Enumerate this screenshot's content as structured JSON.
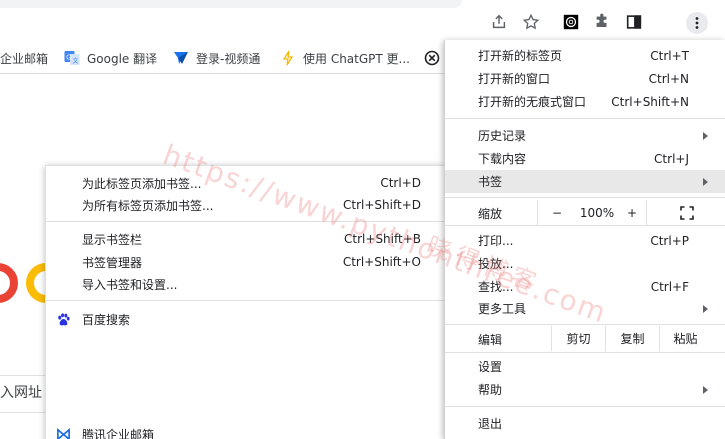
{
  "bookmarks_bar": {
    "items": [
      {
        "label": "企业邮箱"
      },
      {
        "label": "Google 翻译"
      },
      {
        "label": "登录-视频通"
      },
      {
        "label": "使用 ChatGPT 更..."
      }
    ]
  },
  "page": {
    "search_partial": "入网址"
  },
  "bookmark_submenu": {
    "items": [
      {
        "label": "为此标签页添加书签...",
        "shortcut": "Ctrl+D"
      },
      {
        "label": "为所有标签页添加书签...",
        "shortcut": "Ctrl+Shift+D"
      },
      {
        "label": "显示书签栏",
        "shortcut": "Ctrl+Shift+B"
      },
      {
        "label": "书签管理器",
        "shortcut": "Ctrl+Shift+O"
      },
      {
        "label": "导入书签和设置...",
        "shortcut": ""
      },
      {
        "label": "百度搜索",
        "shortcut": ""
      },
      {
        "label": "腾讯企业邮箱",
        "shortcut": ""
      }
    ]
  },
  "main_menu": {
    "new_tab": {
      "label": "打开新的标签页",
      "shortcut": "Ctrl+T"
    },
    "new_window": {
      "label": "打开新的窗口",
      "shortcut": "Ctrl+N"
    },
    "incognito": {
      "label": "打开新的无痕式窗口",
      "shortcut": "Ctrl+Shift+N"
    },
    "history": {
      "label": "历史记录"
    },
    "downloads": {
      "label": "下载内容",
      "shortcut": "Ctrl+J"
    },
    "bookmarks": {
      "label": "书签"
    },
    "zoom": {
      "label": "缩放",
      "minus": "−",
      "value": "100%",
      "plus": "+"
    },
    "print": {
      "label": "打印...",
      "shortcut": "Ctrl+P"
    },
    "cast": {
      "label": "投放..."
    },
    "find": {
      "label": "查找...",
      "shortcut": "Ctrl+F"
    },
    "more_tools": {
      "label": "更多工具"
    },
    "edit": {
      "label": "编辑",
      "cut": "剪切",
      "copy": "复制",
      "paste": "粘贴"
    },
    "settings": {
      "label": "设置"
    },
    "help": {
      "label": "帮助"
    },
    "exit": {
      "label": "退出"
    }
  },
  "watermark": {
    "url": "https://www.pythonthree.com",
    "name": "晓得博客"
  },
  "colors": {
    "highlight": "#e8e8e8",
    "google_red": "#ea4335",
    "google_yellow": "#fbbc05",
    "watermark": "#ea7878"
  }
}
